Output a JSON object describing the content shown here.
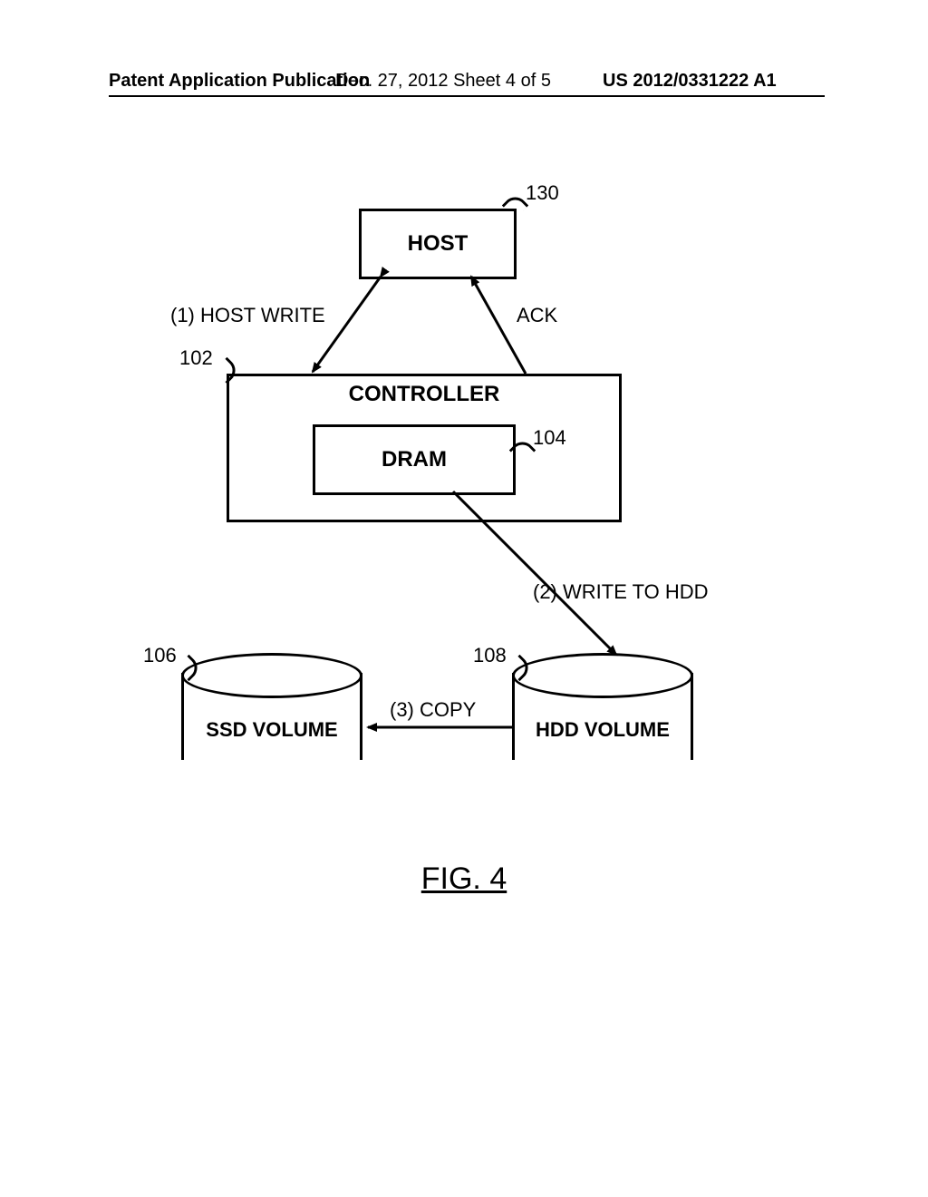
{
  "header": {
    "left": "Patent Application Publication",
    "center": "Dec. 27, 2012  Sheet 4 of 5",
    "right": "US 2012/0331222 A1"
  },
  "refs": {
    "host": "130",
    "controller": "102",
    "dram": "104",
    "ssd": "106",
    "hdd": "108"
  },
  "blocks": {
    "host": "HOST",
    "controller": "CONTROLLER",
    "dram": "DRAM",
    "ssd": "SSD VOLUME",
    "hdd": "HDD VOLUME"
  },
  "edges": {
    "host_write": "(1) HOST WRITE",
    "ack": "ACK",
    "write_hdd": "(2) WRITE TO HDD",
    "copy": "(3) COPY"
  },
  "figure": "FIG. 4"
}
